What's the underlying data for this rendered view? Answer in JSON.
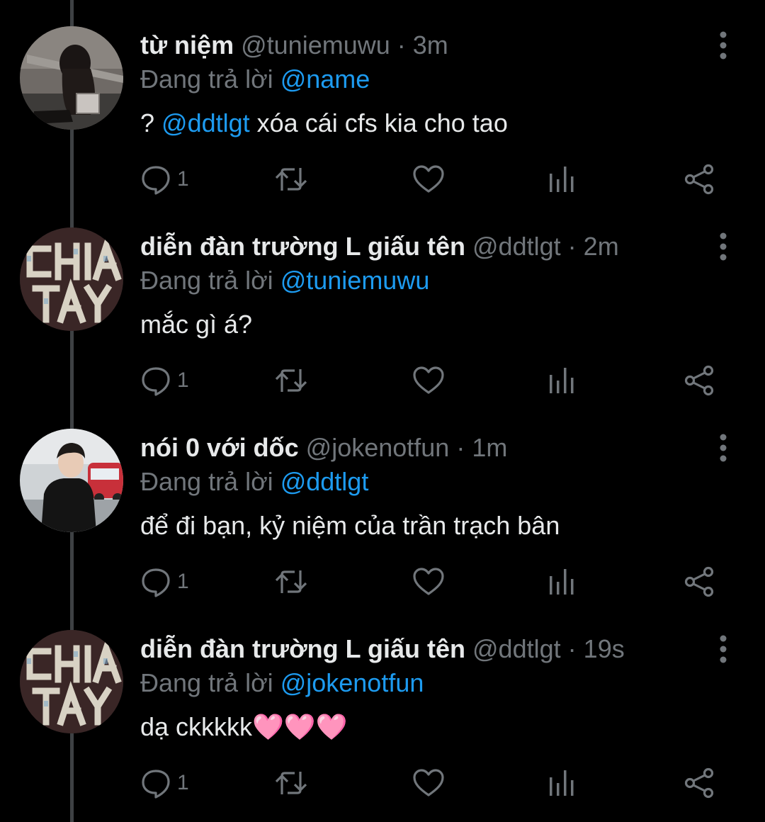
{
  "colors": {
    "background": "#000000",
    "text": "#e7e9ea",
    "secondary": "#71767b",
    "mention": "#1d9bf0",
    "thread_line": "#3e4144"
  },
  "icons": {
    "reply": "speech-bubble-icon",
    "retweet": "retweet-arrows-icon",
    "like": "heart-outline-icon",
    "views": "bar-chart-icon",
    "share": "share-nodes-icon",
    "more": "vertical-ellipsis-icon"
  },
  "tweets": [
    {
      "display_name": "từ niệm",
      "handle": "@tuniemuwu",
      "separator": "·",
      "time": "3m",
      "replying_prefix": "Đang trả lời",
      "replying_to": "@name",
      "body_prefix": "? ",
      "body_mention": "@ddtlgt",
      "body_suffix": " xóa cái cfs kia cho tao",
      "reply_count": "1"
    },
    {
      "display_name": "diễn đàn trường L giấu tên",
      "handle": "@ddtlgt",
      "separator": "·",
      "time": "2m",
      "replying_prefix": "Đang trả lời",
      "replying_to": "@tuniemuwu",
      "body_prefix": "mắc gì á?",
      "body_mention": "",
      "body_suffix": "",
      "reply_count": "1"
    },
    {
      "display_name": "nói 0 với dốc",
      "handle": "@jokenotfun",
      "separator": "·",
      "time": "1m",
      "replying_prefix": "Đang trả lời",
      "replying_to": "@ddtlgt",
      "body_prefix": "để đi bạn, kỷ niệm của trần trạch bân",
      "body_mention": "",
      "body_suffix": "",
      "reply_count": "1"
    },
    {
      "display_name": "diễn đàn trường L giấu tên",
      "handle": "@ddtlgt",
      "separator": "·",
      "time": "19s",
      "replying_prefix": "Đang trả lời",
      "replying_to": "@jokenotfun",
      "body_prefix": "dạ ckkkkk🩷🩷🩷",
      "body_mention": "",
      "body_suffix": "",
      "reply_count": "1"
    }
  ]
}
